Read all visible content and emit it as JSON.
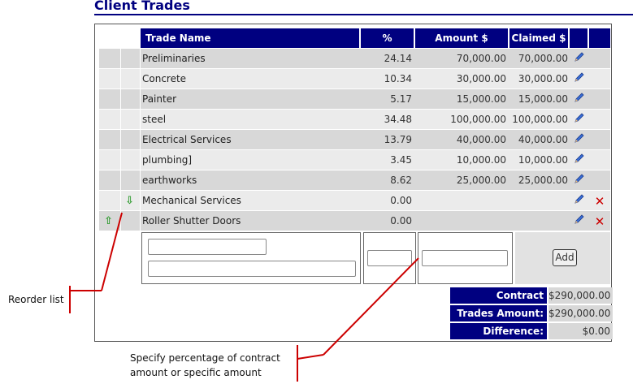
{
  "title": "Client Trades",
  "headers": {
    "name": "Trade Name",
    "pct": "%",
    "amount": "Amount $",
    "claimed": "Claimed $"
  },
  "rows": [
    {
      "name": "Preliminaries",
      "pct": "24.14",
      "amount": "70,000.00",
      "claimed": "70,000.00"
    },
    {
      "name": "Concrete",
      "pct": "10.34",
      "amount": "30,000.00",
      "claimed": "30,000.00"
    },
    {
      "name": "Painter",
      "pct": "5.17",
      "amount": "15,000.00",
      "claimed": "15,000.00"
    },
    {
      "name": "steel",
      "pct": "34.48",
      "amount": "100,000.00",
      "claimed": "100,000.00"
    },
    {
      "name": "Electrical Services",
      "pct": "13.79",
      "amount": "40,000.00",
      "claimed": "40,000.00"
    },
    {
      "name": "plumbing]",
      "pct": "3.45",
      "amount": "10,000.00",
      "claimed": "10,000.00"
    },
    {
      "name": "earthworks",
      "pct": "8.62",
      "amount": "25,000.00",
      "claimed": "25,000.00"
    },
    {
      "name": "Mechanical Services",
      "pct": "0.00",
      "amount": "",
      "claimed": ""
    },
    {
      "name": "Roller Shutter Doors",
      "pct": "0.00",
      "amount": "",
      "claimed": ""
    }
  ],
  "add_label": "Add",
  "summary": {
    "contract_label": "Contract Amount:",
    "contract_value": "$290,000.00",
    "trades_label": "Trades Amount:",
    "trades_value": "$290,000.00",
    "diff_label": "Difference:",
    "diff_value": "$0.00"
  },
  "annotations": {
    "reorder": "Reorder list",
    "specify_line1": "Specify percentage of contract",
    "specify_line2": "amount or specific amount"
  },
  "icons": {
    "edit": "pencil-icon",
    "delete": "delete-x-icon",
    "up": "move-up-arrow-icon",
    "down": "move-down-arrow-icon"
  },
  "colors": {
    "header_bg": "#000080",
    "row_odd": "#d8d8d8",
    "row_even": "#ebebeb",
    "delete": "#cc0000",
    "arrow": "#2e9a2e",
    "callout_line": "#cc0000"
  }
}
